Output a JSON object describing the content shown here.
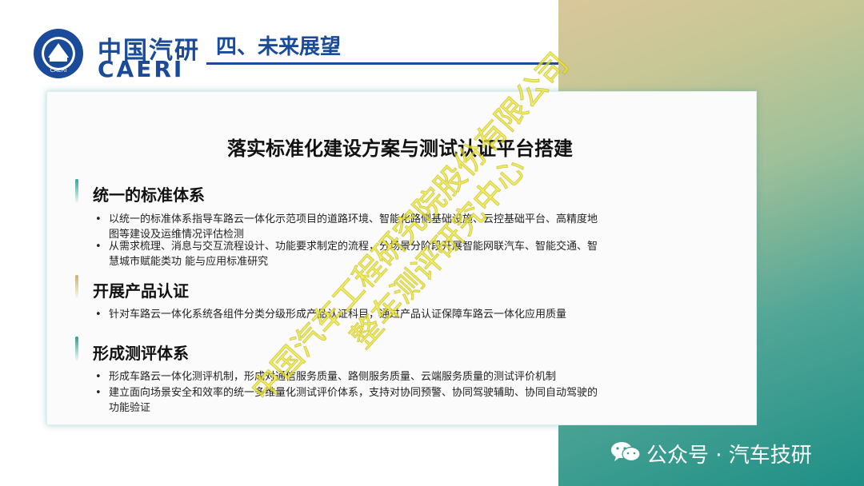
{
  "header": {
    "logo_cn": "中国汽研",
    "logo_en": "CAERI",
    "section_title": "四、未来展望"
  },
  "main_title": "落实标准化建设方案与测试认证平台搭建",
  "sections": [
    {
      "heading": "统一的标准体系",
      "bar_color": "#2fa49a",
      "bullets": [
        "以统一的标准体系指导车路云一体化示范项目的道路环境、智能化路侧基础设施、云控基础平台、高精度地图等建设及运维情况评估检测",
        "从需求梳理、消息与交互流程设计、功能要求制定的流程，分场景分阶段开展智能网联汽车、智能交通、智慧城市赋能类功 能与应用标准研究"
      ]
    },
    {
      "heading": "开展产品认证",
      "bar_color": "#c9b06a",
      "bullets": [
        "针对车路云一体化系统各组件分类分级形成产品认证科目，通过产品认证保障车路云一体化应用质量"
      ]
    },
    {
      "heading": "形成测评体系",
      "bar_color": "#2f9d95",
      "bullets": [
        "形成车路云一体化测评机制，形成对通信服务质量、路侧服务质量、云端服务质量的测试评价机制",
        "建立面向场景安全和效率的统一多维量化测试评价体系，支持对协同预警、协同驾驶辅助、协同自动驾驶的功能验证"
      ]
    }
  ],
  "bullet_symbol": "•",
  "watermark": {
    "line1": "中国汽车工程研究院股份有限公司",
    "line2": "整车测评研究中心"
  },
  "footer": {
    "icon": "wechat-icon",
    "text": "公众号 · 汽车技研"
  }
}
